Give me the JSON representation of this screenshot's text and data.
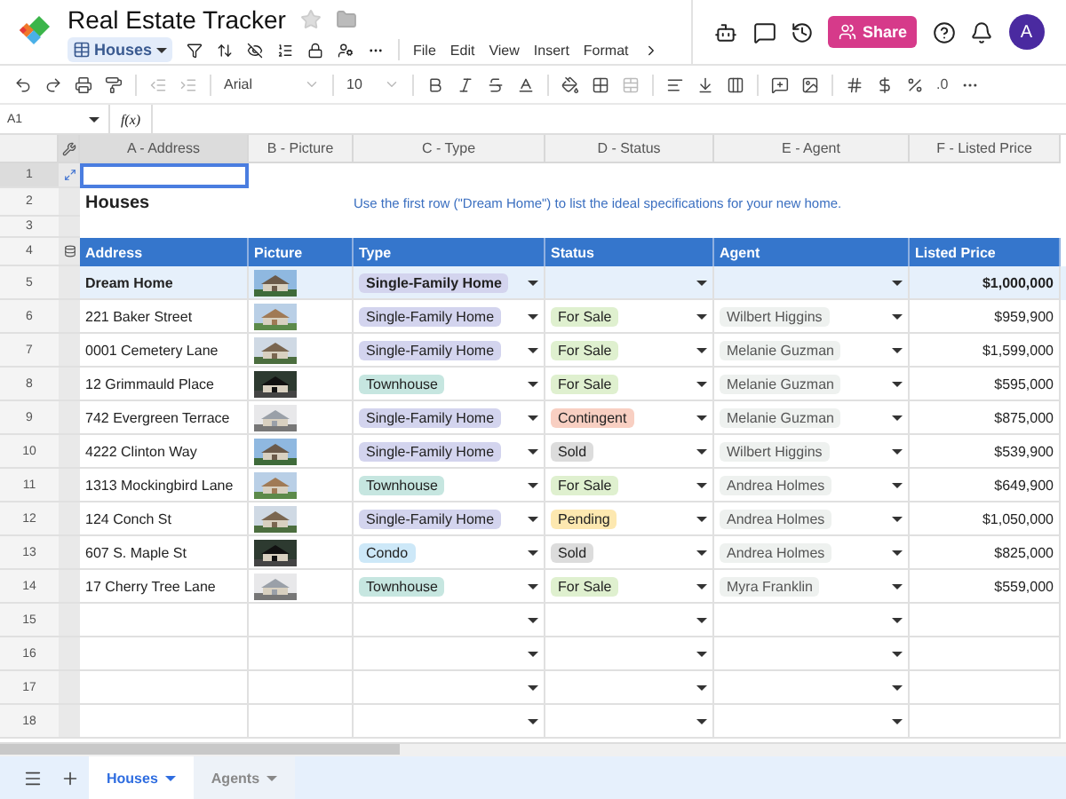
{
  "app": {
    "title": "Real Estate Tracker",
    "view": "Houses",
    "menu": [
      "File",
      "Edit",
      "View",
      "Insert",
      "Format"
    ],
    "share": "Share",
    "avatar": "A"
  },
  "toolbar": {
    "font": "Arial",
    "size": "10",
    "decimal": ".0"
  },
  "formula_bar": {
    "cell": "A1",
    "fx": "f(x)"
  },
  "columns": [
    "A - Address",
    "B - Picture",
    "C - Type",
    "D - Status",
    "E - Agent",
    "F - Listed Price"
  ],
  "top_row_numbers": [
    "1",
    "2",
    "3",
    "4"
  ],
  "sheet_title": "Houses",
  "note": "Use the first row (\"Dream Home\") to list the ideal specifications for your new home.",
  "headers": [
    "Address",
    "Picture",
    "Type",
    "Status",
    "Agent",
    "Listed Price"
  ],
  "rows": [
    {
      "num": "5",
      "highlighted": true,
      "address": "Dream Home",
      "picture": true,
      "type": {
        "text": "Single-Family Home",
        "color": "#d3d4ee"
      },
      "price": "$1,000,000"
    },
    {
      "num": "6",
      "highlighted": false,
      "address": "221 Baker Street",
      "picture": true,
      "type": {
        "text": "Single-Family Home",
        "color": "#d3d4ee"
      },
      "status": {
        "text": "For Sale",
        "color": "#dff0cf"
      },
      "agent": "Wilbert Higgins",
      "price": "$959,900"
    },
    {
      "num": "7",
      "highlighted": false,
      "address": "0001 Cemetery Lane",
      "picture": true,
      "type": {
        "text": "Single-Family Home",
        "color": "#d3d4ee"
      },
      "status": {
        "text": "For Sale",
        "color": "#dff0cf"
      },
      "agent": "Melanie Guzman",
      "price": "$1,599,000"
    },
    {
      "num": "8",
      "highlighted": false,
      "address": "12 Grimmauld Place",
      "picture": true,
      "type": {
        "text": "Townhouse",
        "color": "#c6e6e0"
      },
      "status": {
        "text": "For Sale",
        "color": "#dff0cf"
      },
      "agent": "Melanie Guzman",
      "price": "$595,000"
    },
    {
      "num": "9",
      "highlighted": false,
      "address": "742 Evergreen Terrace",
      "picture": true,
      "type": {
        "text": "Single-Family Home",
        "color": "#d3d4ee"
      },
      "status": {
        "text": "Contingent",
        "color": "#f8cfc2"
      },
      "agent": "Melanie Guzman",
      "price": "$875,000"
    },
    {
      "num": "10",
      "highlighted": false,
      "address": "4222 Clinton Way",
      "picture": true,
      "type": {
        "text": "Single-Family Home",
        "color": "#d3d4ee"
      },
      "status": {
        "text": "Sold",
        "color": "#dcdcdc"
      },
      "agent": "Wilbert Higgins",
      "price": "$539,900"
    },
    {
      "num": "11",
      "highlighted": false,
      "address": "1313 Mockingbird Lane",
      "picture": true,
      "type": {
        "text": "Townhouse",
        "color": "#c6e6e0"
      },
      "status": {
        "text": "For Sale",
        "color": "#dff0cf"
      },
      "agent": "Andrea Holmes",
      "price": "$649,900"
    },
    {
      "num": "12",
      "highlighted": false,
      "address": "124 Conch St",
      "picture": true,
      "type": {
        "text": "Single-Family Home",
        "color": "#d3d4ee"
      },
      "status": {
        "text": "Pending",
        "color": "#fde8b0"
      },
      "agent": "Andrea Holmes",
      "price": "$1,050,000"
    },
    {
      "num": "13",
      "highlighted": false,
      "address": "607 S. Maple St",
      "picture": true,
      "type": {
        "text": "Condo",
        "color": "#cde8f8"
      },
      "status": {
        "text": "Sold",
        "color": "#dcdcdc"
      },
      "agent": "Andrea Holmes",
      "price": "$825,000"
    },
    {
      "num": "14",
      "highlighted": false,
      "address": "17 Cherry Tree Lane",
      "picture": true,
      "type": {
        "text": "Townhouse",
        "color": "#c6e6e0"
      },
      "status": {
        "text": "For Sale",
        "color": "#dff0cf"
      },
      "agent": "Myra Franklin",
      "price": "$559,000"
    },
    {
      "num": "15",
      "highlighted": false,
      "picture": false
    },
    {
      "num": "16",
      "highlighted": false,
      "picture": false
    },
    {
      "num": "17",
      "highlighted": false,
      "picture": false
    },
    {
      "num": "18",
      "highlighted": false,
      "picture": false
    }
  ],
  "tabs": [
    {
      "label": "Houses",
      "selected": true
    },
    {
      "label": "Agents",
      "selected": false
    }
  ]
}
